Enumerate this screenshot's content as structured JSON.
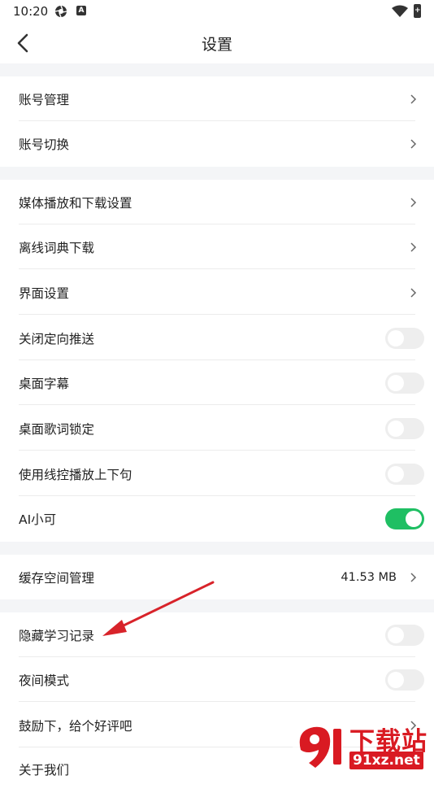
{
  "status_bar": {
    "time": "10:20",
    "badge": "A",
    "battery": "+"
  },
  "header": {
    "title": "设置"
  },
  "settings": {
    "account_manage": "账号管理",
    "account_switch": "账号切换",
    "media_download": "媒体播放和下载设置",
    "offline_dict": "离线词典下载",
    "ui_settings": "界面设置",
    "disable_push": {
      "label": "关闭定向推送",
      "enabled": false
    },
    "desktop_subtitle": {
      "label": "桌面字幕",
      "enabled": false
    },
    "desktop_lyrics_lock": {
      "label": "桌面歌词锁定",
      "enabled": false
    },
    "wire_control": {
      "label": "使用线控播放上下句",
      "enabled": false
    },
    "ai_xiaoke": {
      "label": "AI小可",
      "enabled": true
    },
    "cache": {
      "label": "缓存空间管理",
      "value": "41.53 MB"
    },
    "hide_study": {
      "label": "隐藏学习记录",
      "enabled": false
    },
    "night_mode": {
      "label": "夜间模式",
      "enabled": false
    },
    "rate_us": "鼓励下，给个好评吧",
    "about_us": "关于我们"
  },
  "watermark": {
    "brand": "下载站",
    "url": "91xz.net"
  },
  "colors": {
    "toggle_on": "#1fbf63",
    "toggle_off": "#eeeeee",
    "section_gap": "#f4f5f7",
    "annotation_arrow": "#d8232a",
    "watermark_red": "#d91a22"
  }
}
